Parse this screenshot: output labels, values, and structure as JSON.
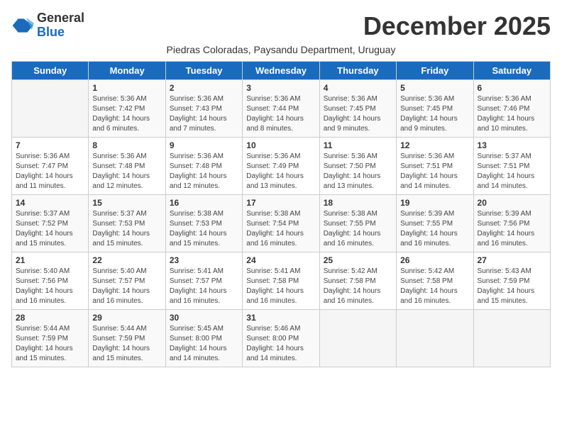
{
  "logo": {
    "general": "General",
    "blue": "Blue"
  },
  "header": {
    "month_year": "December 2025",
    "subtitle": "Piedras Coloradas, Paysandu Department, Uruguay"
  },
  "days_of_week": [
    "Sunday",
    "Monday",
    "Tuesday",
    "Wednesday",
    "Thursday",
    "Friday",
    "Saturday"
  ],
  "weeks": [
    [
      {
        "day": "",
        "sunrise": "",
        "sunset": "",
        "daylight": ""
      },
      {
        "day": "1",
        "sunrise": "Sunrise: 5:36 AM",
        "sunset": "Sunset: 7:42 PM",
        "daylight": "Daylight: 14 hours and 6 minutes."
      },
      {
        "day": "2",
        "sunrise": "Sunrise: 5:36 AM",
        "sunset": "Sunset: 7:43 PM",
        "daylight": "Daylight: 14 hours and 7 minutes."
      },
      {
        "day": "3",
        "sunrise": "Sunrise: 5:36 AM",
        "sunset": "Sunset: 7:44 PM",
        "daylight": "Daylight: 14 hours and 8 minutes."
      },
      {
        "day": "4",
        "sunrise": "Sunrise: 5:36 AM",
        "sunset": "Sunset: 7:45 PM",
        "daylight": "Daylight: 14 hours and 9 minutes."
      },
      {
        "day": "5",
        "sunrise": "Sunrise: 5:36 AM",
        "sunset": "Sunset: 7:45 PM",
        "daylight": "Daylight: 14 hours and 9 minutes."
      },
      {
        "day": "6",
        "sunrise": "Sunrise: 5:36 AM",
        "sunset": "Sunset: 7:46 PM",
        "daylight": "Daylight: 14 hours and 10 minutes."
      }
    ],
    [
      {
        "day": "7",
        "sunrise": "Sunrise: 5:36 AM",
        "sunset": "Sunset: 7:47 PM",
        "daylight": "Daylight: 14 hours and 11 minutes."
      },
      {
        "day": "8",
        "sunrise": "Sunrise: 5:36 AM",
        "sunset": "Sunset: 7:48 PM",
        "daylight": "Daylight: 14 hours and 12 minutes."
      },
      {
        "day": "9",
        "sunrise": "Sunrise: 5:36 AM",
        "sunset": "Sunset: 7:48 PM",
        "daylight": "Daylight: 14 hours and 12 minutes."
      },
      {
        "day": "10",
        "sunrise": "Sunrise: 5:36 AM",
        "sunset": "Sunset: 7:49 PM",
        "daylight": "Daylight: 14 hours and 13 minutes."
      },
      {
        "day": "11",
        "sunrise": "Sunrise: 5:36 AM",
        "sunset": "Sunset: 7:50 PM",
        "daylight": "Daylight: 14 hours and 13 minutes."
      },
      {
        "day": "12",
        "sunrise": "Sunrise: 5:36 AM",
        "sunset": "Sunset: 7:51 PM",
        "daylight": "Daylight: 14 hours and 14 minutes."
      },
      {
        "day": "13",
        "sunrise": "Sunrise: 5:37 AM",
        "sunset": "Sunset: 7:51 PM",
        "daylight": "Daylight: 14 hours and 14 minutes."
      }
    ],
    [
      {
        "day": "14",
        "sunrise": "Sunrise: 5:37 AM",
        "sunset": "Sunset: 7:52 PM",
        "daylight": "Daylight: 14 hours and 15 minutes."
      },
      {
        "day": "15",
        "sunrise": "Sunrise: 5:37 AM",
        "sunset": "Sunset: 7:53 PM",
        "daylight": "Daylight: 14 hours and 15 minutes."
      },
      {
        "day": "16",
        "sunrise": "Sunrise: 5:38 AM",
        "sunset": "Sunset: 7:53 PM",
        "daylight": "Daylight: 14 hours and 15 minutes."
      },
      {
        "day": "17",
        "sunrise": "Sunrise: 5:38 AM",
        "sunset": "Sunset: 7:54 PM",
        "daylight": "Daylight: 14 hours and 16 minutes."
      },
      {
        "day": "18",
        "sunrise": "Sunrise: 5:38 AM",
        "sunset": "Sunset: 7:55 PM",
        "daylight": "Daylight: 14 hours and 16 minutes."
      },
      {
        "day": "19",
        "sunrise": "Sunrise: 5:39 AM",
        "sunset": "Sunset: 7:55 PM",
        "daylight": "Daylight: 14 hours and 16 minutes."
      },
      {
        "day": "20",
        "sunrise": "Sunrise: 5:39 AM",
        "sunset": "Sunset: 7:56 PM",
        "daylight": "Daylight: 14 hours and 16 minutes."
      }
    ],
    [
      {
        "day": "21",
        "sunrise": "Sunrise: 5:40 AM",
        "sunset": "Sunset: 7:56 PM",
        "daylight": "Daylight: 14 hours and 16 minutes."
      },
      {
        "day": "22",
        "sunrise": "Sunrise: 5:40 AM",
        "sunset": "Sunset: 7:57 PM",
        "daylight": "Daylight: 14 hours and 16 minutes."
      },
      {
        "day": "23",
        "sunrise": "Sunrise: 5:41 AM",
        "sunset": "Sunset: 7:57 PM",
        "daylight": "Daylight: 14 hours and 16 minutes."
      },
      {
        "day": "24",
        "sunrise": "Sunrise: 5:41 AM",
        "sunset": "Sunset: 7:58 PM",
        "daylight": "Daylight: 14 hours and 16 minutes."
      },
      {
        "day": "25",
        "sunrise": "Sunrise: 5:42 AM",
        "sunset": "Sunset: 7:58 PM",
        "daylight": "Daylight: 14 hours and 16 minutes."
      },
      {
        "day": "26",
        "sunrise": "Sunrise: 5:42 AM",
        "sunset": "Sunset: 7:58 PM",
        "daylight": "Daylight: 14 hours and 16 minutes."
      },
      {
        "day": "27",
        "sunrise": "Sunrise: 5:43 AM",
        "sunset": "Sunset: 7:59 PM",
        "daylight": "Daylight: 14 hours and 15 minutes."
      }
    ],
    [
      {
        "day": "28",
        "sunrise": "Sunrise: 5:44 AM",
        "sunset": "Sunset: 7:59 PM",
        "daylight": "Daylight: 14 hours and 15 minutes."
      },
      {
        "day": "29",
        "sunrise": "Sunrise: 5:44 AM",
        "sunset": "Sunset: 7:59 PM",
        "daylight": "Daylight: 14 hours and 15 minutes."
      },
      {
        "day": "30",
        "sunrise": "Sunrise: 5:45 AM",
        "sunset": "Sunset: 8:00 PM",
        "daylight": "Daylight: 14 hours and 14 minutes."
      },
      {
        "day": "31",
        "sunrise": "Sunrise: 5:46 AM",
        "sunset": "Sunset: 8:00 PM",
        "daylight": "Daylight: 14 hours and 14 minutes."
      },
      {
        "day": "",
        "sunrise": "",
        "sunset": "",
        "daylight": ""
      },
      {
        "day": "",
        "sunrise": "",
        "sunset": "",
        "daylight": ""
      },
      {
        "day": "",
        "sunrise": "",
        "sunset": "",
        "daylight": ""
      }
    ]
  ]
}
